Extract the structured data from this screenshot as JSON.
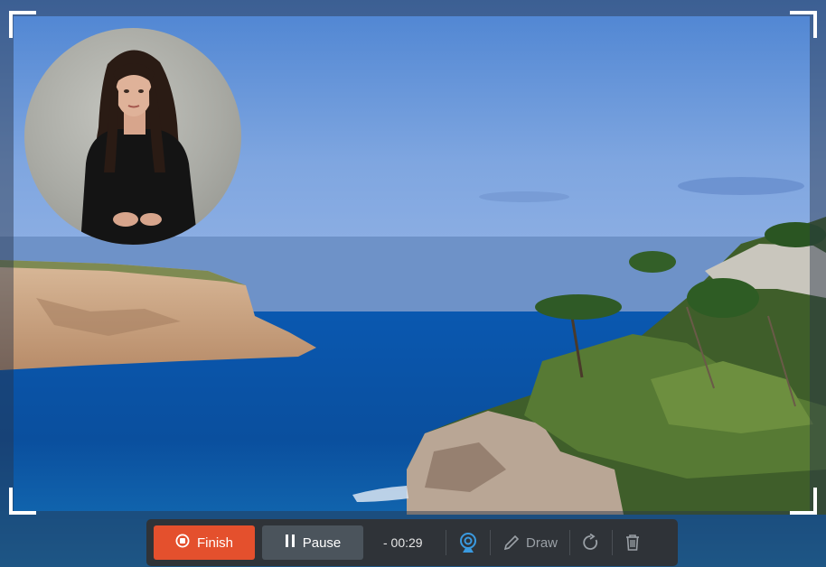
{
  "toolbar": {
    "finish_label": "Finish",
    "pause_label": "Pause",
    "timer": "- 00:29",
    "draw_label": "Draw",
    "icons": {
      "finish": "stop-circle-icon",
      "pause": "pause-icon",
      "webcam": "webcam-icon",
      "draw": "pencil-icon",
      "redo": "rotate-icon",
      "delete": "trash-icon"
    }
  },
  "colors": {
    "finish": "#e4502d",
    "pause": "#4b545c",
    "toolbar_bg": "#2f3338",
    "webcam_active": "#3a9ae0",
    "inactive_icon": "#9aa0a6"
  }
}
